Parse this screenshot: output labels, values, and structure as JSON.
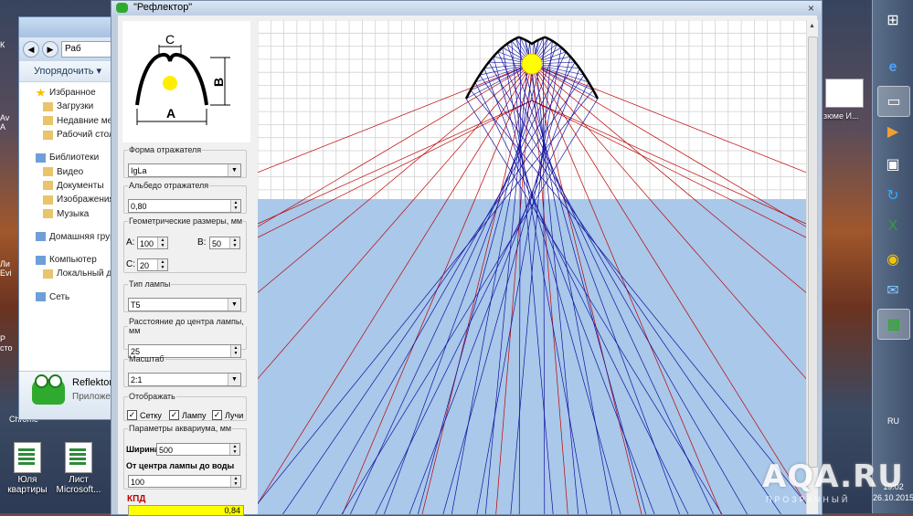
{
  "desktop": {
    "icons_left": [
      {
        "label": "Юля квартиры"
      },
      {
        "label": "Лист Microsoft..."
      }
    ],
    "partial_labels": [
      "К",
      "Av",
      "A",
      "Ли",
      "Evi",
      "Р",
      "сто",
      "Chrome"
    ],
    "right_icon_label": "зюме И..."
  },
  "explorer": {
    "address": "Раб",
    "toolbar_label": "Упорядочить ▾",
    "tree": [
      {
        "label": "Избранное",
        "icon": "star-icon",
        "level": 0
      },
      {
        "label": "Загрузки",
        "icon": "download-folder-icon",
        "level": 1
      },
      {
        "label": "Недавние мест",
        "icon": "recent-places-icon",
        "level": 1
      },
      {
        "label": "Рабочий стол",
        "icon": "desktop-icon",
        "level": 1
      },
      {
        "label": "",
        "level": -1
      },
      {
        "label": "Библиотеки",
        "icon": "libraries-icon",
        "level": 0
      },
      {
        "label": "Видео",
        "icon": "video-icon",
        "level": 1
      },
      {
        "label": "Документы",
        "icon": "documents-icon",
        "level": 1
      },
      {
        "label": "Изображения",
        "icon": "pictures-icon",
        "level": 1
      },
      {
        "label": "Музыка",
        "icon": "music-icon",
        "level": 1
      },
      {
        "label": "",
        "level": -1
      },
      {
        "label": "Домашняя групп",
        "icon": "homegroup-icon",
        "level": 0
      },
      {
        "label": "",
        "level": -1
      },
      {
        "label": "Компьютер",
        "icon": "computer-icon",
        "level": 0
      },
      {
        "label": "Локальный дис",
        "icon": "local-disk-icon",
        "level": 1
      },
      {
        "label": "",
        "level": -1
      },
      {
        "label": "Сеть",
        "icon": "network-icon",
        "level": 0
      }
    ],
    "details_name": "Reflektor",
    "details_type": "Приложен"
  },
  "window": {
    "title": "\"Рефлектор\"",
    "close": "×"
  },
  "diagram": {
    "label_c": "C",
    "label_b": "B",
    "label_a": "A"
  },
  "form": {
    "shape": {
      "legend": "Форма отражателя",
      "value": "IgLa"
    },
    "albedo": {
      "legend": "Альбедо отражателя",
      "value": "0,80"
    },
    "dims": {
      "legend": "Геометрические размеры, мм",
      "a_label": "A:",
      "a_value": "100",
      "b_label": "B:",
      "b_value": "50",
      "c_label": "C:",
      "c_value": "20"
    },
    "lamp": {
      "legend": "Тип лампы",
      "value": "T5"
    },
    "distance": {
      "legend": "Расстояние до центра лампы, мм",
      "value": "25"
    },
    "scale": {
      "legend": "Масштаб",
      "value": "2:1"
    },
    "display": {
      "legend": "Отображать",
      "grid": {
        "label": "Сетку",
        "checked": true
      },
      "lamp": {
        "label": "Лампу",
        "checked": true
      },
      "rays": {
        "label": "Лучи",
        "checked": true
      }
    },
    "aquarium": {
      "legend": "Параметры аквариума, мм",
      "width_label": "Ширина",
      "width_value": "500",
      "dist_label": "От центра лампы до воды",
      "dist_value": "100"
    },
    "efficiency": {
      "label": "КПД",
      "value": "0,84"
    }
  },
  "plot": {
    "colors": {
      "grid": "#d2d2d2",
      "water": "#a9c8ea",
      "ray_red": "#c00000",
      "ray_blue": "#1010a0",
      "reflector": "#000000",
      "lamp": "#ffff00"
    }
  },
  "taskbar": {
    "language": "RU",
    "time": "19:02",
    "date": "26.10.2015",
    "buttons": [
      "windows-start-icon",
      "ie-icon",
      "explorer-icon",
      "media-player-icon",
      "remote-icon",
      "sync-icon",
      "excel-icon",
      "chrome-icon",
      "thunderbird-icon",
      "reflektor-icon"
    ]
  },
  "watermark": {
    "text": "AQA.RU",
    "sub": "ПРОЗРАЧНЫЙ"
  }
}
